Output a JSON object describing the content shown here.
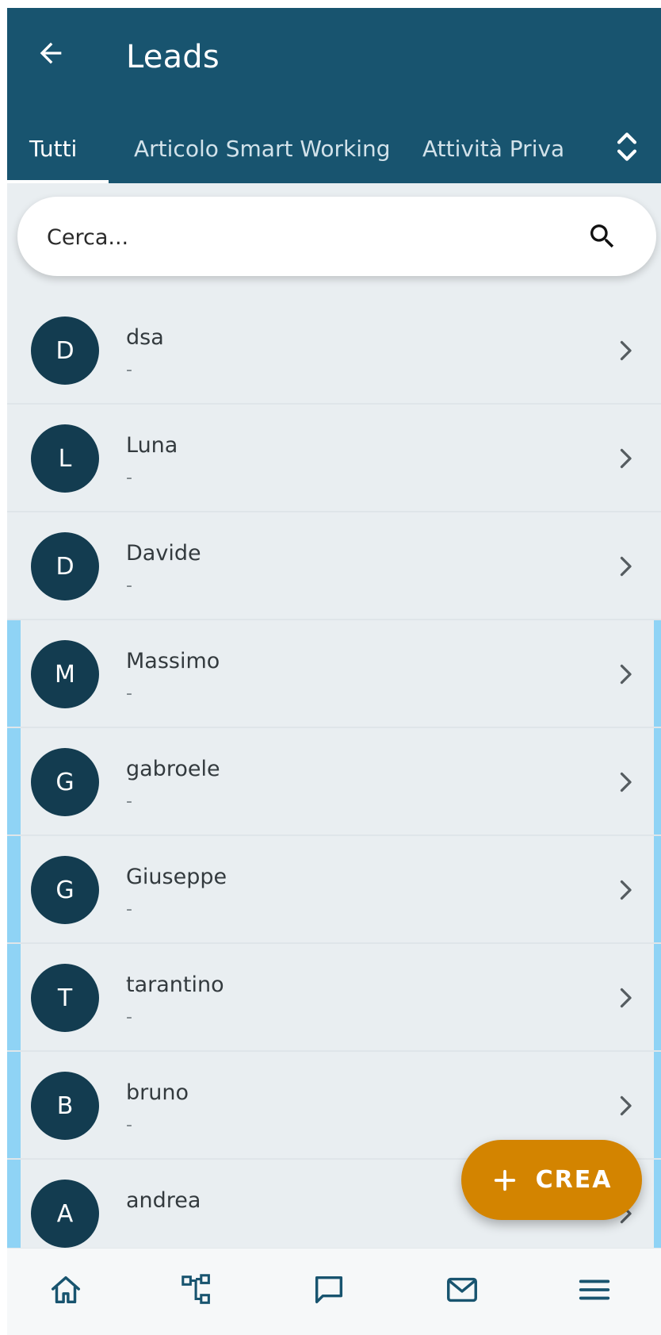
{
  "app_bar": {
    "title": "Leads",
    "back_icon": "arrow-left-icon",
    "background_color": "#18546f"
  },
  "tabs": [
    {
      "label": "Tutti",
      "active": true
    },
    {
      "label": "Articolo Smart Working",
      "active": false
    },
    {
      "label": "Attività Priva",
      "active": false
    }
  ],
  "tabs_scroll_icon": "chevron-up-down-icon",
  "search": {
    "placeholder": "Cerca...",
    "value": "",
    "icon": "search-icon"
  },
  "leads": [
    {
      "initial": "D",
      "name": "dsa",
      "subtitle": "-"
    },
    {
      "initial": "L",
      "name": "Luna",
      "subtitle": "-"
    },
    {
      "initial": "D",
      "name": "Davide",
      "subtitle": "-"
    },
    {
      "initial": "M",
      "name": "Massimo",
      "subtitle": "-"
    },
    {
      "initial": "G",
      "name": "gabroele",
      "subtitle": "-"
    },
    {
      "initial": "G",
      "name": "Giuseppe",
      "subtitle": "-"
    },
    {
      "initial": "T",
      "name": "tarantino",
      "subtitle": "-"
    },
    {
      "initial": "B",
      "name": "bruno",
      "subtitle": "-"
    },
    {
      "initial": "A",
      "name": "andrea",
      "subtitle": ""
    }
  ],
  "fab": {
    "label": "CREA",
    "icon": "plus-icon",
    "color": "#d38400"
  },
  "bottom_nav": [
    {
      "icon": "home-icon"
    },
    {
      "icon": "org-chart-icon"
    },
    {
      "icon": "chat-icon"
    },
    {
      "icon": "mail-icon"
    },
    {
      "icon": "menu-icon"
    }
  ],
  "colors": {
    "avatar": "#133c50",
    "highlight": "#8fd3f5",
    "list_background": "#e9eef1"
  }
}
